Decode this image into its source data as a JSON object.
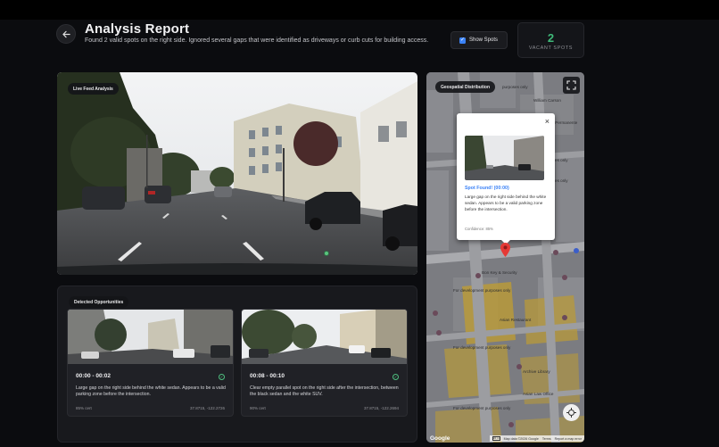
{
  "header": {
    "back_icon": "arrow-left-icon",
    "title": "Analysis Report",
    "subtitle": "Found 2 valid spots on the right side. Ignored several gaps that were identified as driveways or curb cuts for building access.",
    "show_spots_label": "Show Spots",
    "show_spots_checked": true,
    "vacant_count": "2",
    "vacant_label": "VACANT SPOTS"
  },
  "live_feed": {
    "label": "Live Feed Analysis"
  },
  "opportunities": {
    "label": "Detected Opportunities",
    "items": [
      {
        "time": "00:00 - 00:02",
        "description": "Large gap on the right side behind the white sedan. Appears to be a valid parking zone before the intersection.",
        "confidence": "85% cert",
        "coords": "37.8715, -122.2726"
      },
      {
        "time": "00:08 - 00:10",
        "description": "Clear empty parallel spot on the right side after the intersection, between the black sedan and the white SUV.",
        "confidence": "90% cert",
        "coords": "37.8715, -122.2694"
      }
    ]
  },
  "map": {
    "label": "Geospatial Distribution",
    "popup": {
      "title": "Spot Found! (00:00)",
      "description": "Large gap on the right side behind the white sedan. Appears to be a valid parking zone before the intersection.",
      "confidence": "Confidence: 85%"
    },
    "street_labels": [
      "purposes only",
      "William Carson",
      "Kaiser Permanente",
      "purposes only",
      "purposes only",
      "Bon Key & Security",
      "For development purposes only",
      "Asian Restaurant",
      "For development purposes only",
      "Archive Library",
      "Asian Law Office",
      "For development purposes only"
    ],
    "footer": {
      "logo": "Google",
      "scale": "20 m",
      "data": "Map data ©2026 Google",
      "terms": "Terms",
      "report": "Report a map error"
    }
  },
  "colors": {
    "accent_green": "#3fb979",
    "accent_blue": "#3b82f6",
    "pin_red": "#e53935"
  }
}
